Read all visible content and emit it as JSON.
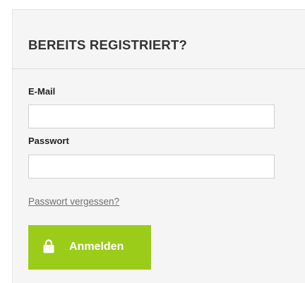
{
  "login": {
    "title": "BEREITS REGISTRIERT?",
    "email_label": "E-Mail",
    "email_value": "",
    "password_label": "Passwort",
    "password_value": "",
    "forgot_link": "Passwort vergessen?",
    "submit_label": "Anmelden",
    "submit_icon": "lock-icon",
    "accent_color": "#9bcc1a"
  }
}
